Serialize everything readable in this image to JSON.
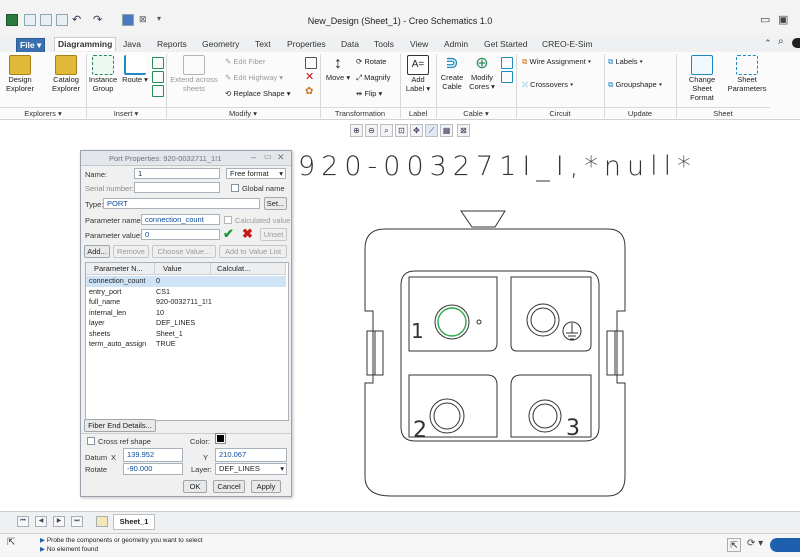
{
  "window": {
    "title": "New_Design (Sheet_1) - Creo Schematics 1.0"
  },
  "tabs": [
    "File",
    "Diagramming",
    "Java",
    "Reports",
    "Geometry",
    "Text",
    "Properties",
    "Data",
    "Tools",
    "View",
    "Admin",
    "Get Started",
    "CREO-E-Sim"
  ],
  "ribbon": {
    "design_explorer": [
      "Design",
      "Explorer"
    ],
    "catalog_explorer": [
      "Catalog",
      "Explorer"
    ],
    "instance_group": [
      "Instance",
      "Group"
    ],
    "route": "Route",
    "extend_across_sheets": [
      "Extend across",
      "sheets"
    ],
    "edit_fiber": "Edit Fiber",
    "edit_highway": "Edit Highway",
    "replace_shape": "Replace Shape",
    "move": "Move",
    "rotate": "Rotate",
    "magnify": "Magnify",
    "flip": "Flip",
    "add_label": [
      "Add",
      "Label"
    ],
    "create_cable": [
      "Create",
      "Cable"
    ],
    "modify_cores": [
      "Modify",
      "Cores"
    ],
    "wire_assignment": "Wire Assignment",
    "crossovers": "Crossovers",
    "labels": "Labels",
    "groupshape": "Groupshape",
    "change_sheet_format": [
      "Change",
      "Sheet Format"
    ],
    "sheet_parameters": [
      "Sheet",
      "Parameters"
    ],
    "groups": [
      "Explorers",
      "Insert",
      "Modify",
      "Transformation",
      "Label",
      "Cable",
      "Circuit",
      "Update",
      "Sheet"
    ]
  },
  "dialog": {
    "title": "Port Properties: 920-0032711_1!1",
    "name_label": "Name:",
    "name_value": "1",
    "format_value": "Free format",
    "serial_label": "Serial number:",
    "global_name_label": "Global name",
    "type_label": "Type:",
    "type_value": "PORT",
    "set_button": "Set...",
    "param_name_label": "Parameter name:",
    "param_name_value": "connection_count",
    "calculated_value_label": "Calculated value",
    "param_value_label": "Parameter value:",
    "param_value_value": "0",
    "unset_button": "Unset",
    "add_button": "Add...",
    "remove_button": "Remove",
    "choose_value_button": "Choose Value...",
    "add_to_value_list_button": "Add to Value List",
    "table_headers": [
      "Parameter N...",
      "Value",
      "Calculat..."
    ],
    "table_rows": [
      {
        "name": "connection_count",
        "value": "0"
      },
      {
        "name": "entry_port",
        "value": "CS1"
      },
      {
        "name": "full_name",
        "value": "920-0032711_1!1"
      },
      {
        "name": "internal_len",
        "value": "10"
      },
      {
        "name": "layer",
        "value": "DEF_LINES"
      },
      {
        "name": "sheets",
        "value": "Sheet_1"
      },
      {
        "name": "term_auto_assign",
        "value": "TRUE"
      }
    ],
    "fiber_end_button": "Fiber End Details...",
    "cross_ref_label": "Cross ref shape",
    "color_label": "Color:",
    "datum_label": "Datum",
    "x_label": "X",
    "x_value": "139.952",
    "y_label": "Y",
    "y_value": "210.067",
    "rotate_label": "Rotate",
    "rotate_value": "-90.000",
    "layer_label": "Layer:",
    "layer_value": "DEF_LINES",
    "ok_button": "OK",
    "cancel_button": "Cancel",
    "apply_button": "Apply"
  },
  "canvas": {
    "component_name": "920-003271I_I,*null*",
    "pin_labels": [
      "1",
      "2",
      "3"
    ]
  },
  "sheet_tab": "Sheet_1",
  "status": {
    "line1": "Probe the components or geometry you want to select",
    "line2": "No element found"
  }
}
